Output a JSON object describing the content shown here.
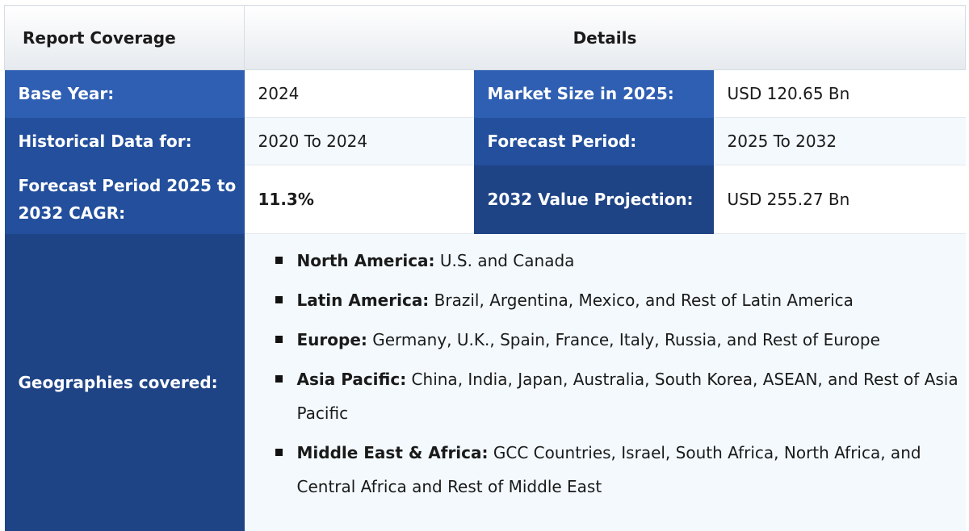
{
  "header": {
    "col1": "Report Coverage",
    "col2": "Details"
  },
  "rows": [
    {
      "label": "Base Year:",
      "value": "2024",
      "label2": "Market Size in 2025:",
      "value2": "USD 120.65 Bn"
    },
    {
      "label": "Historical Data for:",
      "value": "2020 To 2024",
      "label2": "Forecast Period:",
      "value2": "2025 To 2032"
    },
    {
      "label": "Forecast Period 2025 to 2032 CAGR:",
      "value": "11.3%",
      "label2": "2032 Value Projection:",
      "value2": "USD 255.27 Bn"
    }
  ],
  "geographies": {
    "label": "Geographies covered:",
    "items": [
      {
        "region": "North America:",
        "countries": " U.S. and Canada"
      },
      {
        "region": "Latin America:",
        "countries": " Brazil, Argentina, Mexico, and Rest of Latin America"
      },
      {
        "region": "Europe:",
        "countries": " Germany, U.K., Spain, France, Italy, Russia, and Rest of Europe"
      },
      {
        "region": "Asia Pacific:",
        "countries": " China, India, Japan, Australia, South Korea, ASEAN, and Rest of Asia Pacific"
      },
      {
        "region": "Middle East & Africa:",
        "countries": " GCC Countries, Israel,  South Africa, North Africa, and Central Africa and Rest of Middle East"
      }
    ]
  },
  "colors": {
    "label_blue_1": "#2f5fb3",
    "label_blue_2": "#234f9c",
    "label_blue_3": "#1f4486",
    "alt_row": "#f3f9fc"
  }
}
